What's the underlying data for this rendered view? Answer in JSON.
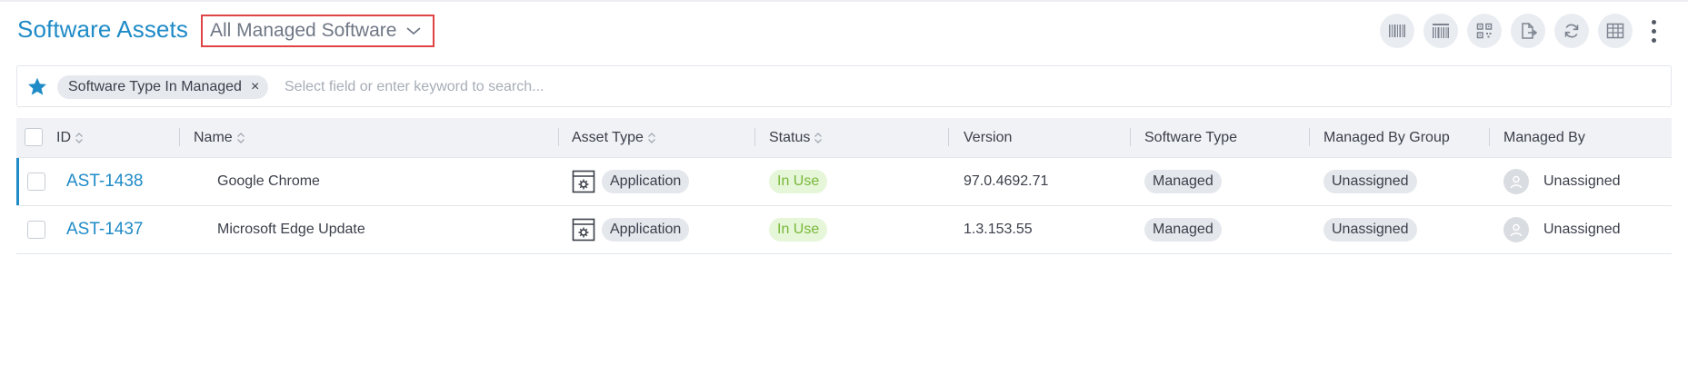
{
  "header": {
    "title": "Software Assets",
    "view_selector": "All Managed Software"
  },
  "toolbar": {
    "buttons": [
      "barcode-icon",
      "barcode-print-icon",
      "qr-code-icon",
      "export-icon",
      "refresh-icon",
      "column-layout-icon"
    ]
  },
  "search": {
    "filter_chip": "Software Type In Managed",
    "chip_remove": "×",
    "placeholder": "Select field or enter keyword to search..."
  },
  "table": {
    "columns": {
      "id": "ID",
      "name": "Name",
      "asset_type": "Asset Type",
      "status": "Status",
      "version": "Version",
      "software_type": "Software Type",
      "managed_by_group": "Managed By Group",
      "managed_by": "Managed By"
    },
    "rows": [
      {
        "id": "AST-1438",
        "name": "Google Chrome",
        "asset_type": "Application",
        "status": "In Use",
        "version": "97.0.4692.71",
        "software_type": "Managed",
        "managed_by_group": "Unassigned",
        "managed_by": "Unassigned"
      },
      {
        "id": "AST-1437",
        "name": "Microsoft Edge Update",
        "asset_type": "Application",
        "status": "In Use",
        "version": "1.3.153.55",
        "software_type": "Managed",
        "managed_by_group": "Unassigned",
        "managed_by": "Unassigned"
      }
    ]
  },
  "colors": {
    "accent": "#1f8bc7",
    "status_in_use": "#78b83a",
    "highlight_border": "#e04343"
  }
}
